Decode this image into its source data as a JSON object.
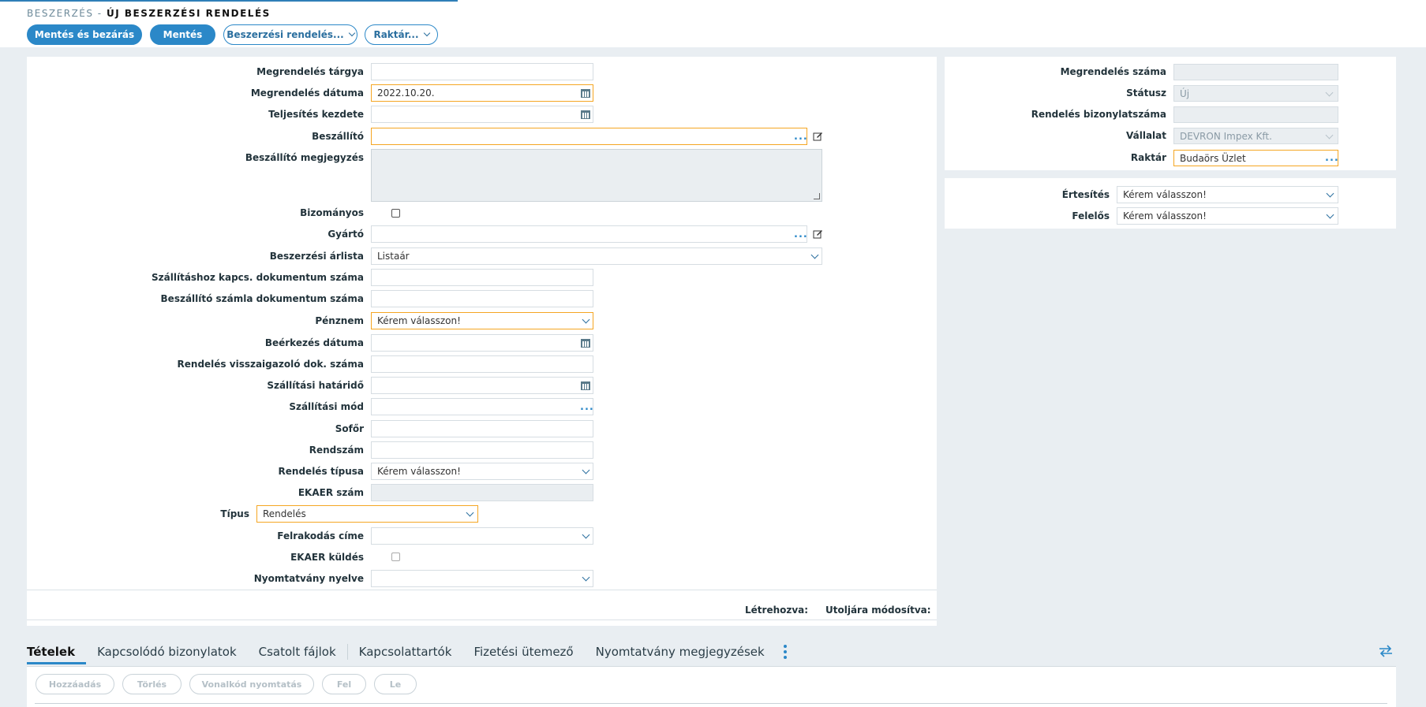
{
  "breadcrumb": {
    "parent": "BESZERZÉS -",
    "title": "ÚJ BESZERZÉSI RENDELÉS"
  },
  "toolbar": {
    "save_close": "Mentés és bezárás",
    "save": "Mentés",
    "purchase_orders": "Beszerzési rendelés...",
    "warehouse": "Raktár..."
  },
  "form": {
    "targy": {
      "label": "Megrendelés tárgya",
      "value": ""
    },
    "datum": {
      "label": "Megrendelés dátuma",
      "value": "2022.10.20."
    },
    "teljesites": {
      "label": "Teljesítés kezdete",
      "value": ""
    },
    "beszallito": {
      "label": "Beszállító",
      "value": ""
    },
    "beszallito_megj": {
      "label": "Beszállító megjegyzés"
    },
    "bizomanyos": {
      "label": "Bizományos"
    },
    "gyarto": {
      "label": "Gyártó",
      "value": ""
    },
    "arlista": {
      "label": "Beszerzési árlista",
      "value": "Listaár"
    },
    "szall_dok": {
      "label": "Szállításhoz kapcs. dokumentum száma",
      "value": ""
    },
    "szamla_dok": {
      "label": "Beszállító számla dokumentum száma",
      "value": ""
    },
    "penznem": {
      "label": "Pénznem",
      "value": "Kérem válasszon!"
    },
    "beerkezes": {
      "label": "Beérkezés dátuma",
      "value": ""
    },
    "visszaig": {
      "label": "Rendelés visszaigazoló dok. száma",
      "value": ""
    },
    "hatarido": {
      "label": "Szállítási határidő",
      "value": ""
    },
    "mod": {
      "label": "Szállítási mód",
      "value": ""
    },
    "sofor": {
      "label": "Sofőr",
      "value": ""
    },
    "rendszam": {
      "label": "Rendszám",
      "value": ""
    },
    "rend_tipus": {
      "label": "Rendelés típusa",
      "value": "Kérem válasszon!"
    },
    "ekaer": {
      "label": "EKAER szám",
      "value": ""
    },
    "tipus": {
      "label": "Típus",
      "value": "Rendelés"
    },
    "felrakodas": {
      "label": "Felrakodás címe",
      "value": ""
    },
    "ekaer_kuldes": {
      "label": "EKAER küldés"
    },
    "nyelv": {
      "label": "Nyomtatvány nyelve",
      "value": ""
    }
  },
  "footer_meta": {
    "created": "Létrehozva:",
    "modified": "Utoljára módosítva:"
  },
  "right": {
    "szam": {
      "label": "Megrendelés száma",
      "value": ""
    },
    "statusz": {
      "label": "Státusz",
      "value": "Új"
    },
    "bizonylat": {
      "label": "Rendelés bizonylatszáma",
      "value": ""
    },
    "vallalat": {
      "label": "Vállalat",
      "value": "DEVRON Impex Kft."
    },
    "raktar": {
      "label": "Raktár",
      "value": "Budaörs Üzlet"
    },
    "ertesites": {
      "label": "Értesítés",
      "value": "Kérem válasszon!"
    },
    "felelos": {
      "label": "Felelős",
      "value": "Kérem válasszon!"
    }
  },
  "tabs": [
    "Tételek",
    "Kapcsolódó bizonylatok",
    "Csatolt fájlok",
    "Kapcsolattartók",
    "Fizetési ütemező",
    "Nyomtatvány megjegyzések"
  ],
  "items_toolbar": {
    "add": "Hozzáadás",
    "delete": "Törlés",
    "barcode": "Vonalkód nyomtatás",
    "up": "Fel",
    "down": "Le"
  },
  "colors": {
    "accent": "#2b88c8",
    "required_border": "#f5a623"
  }
}
